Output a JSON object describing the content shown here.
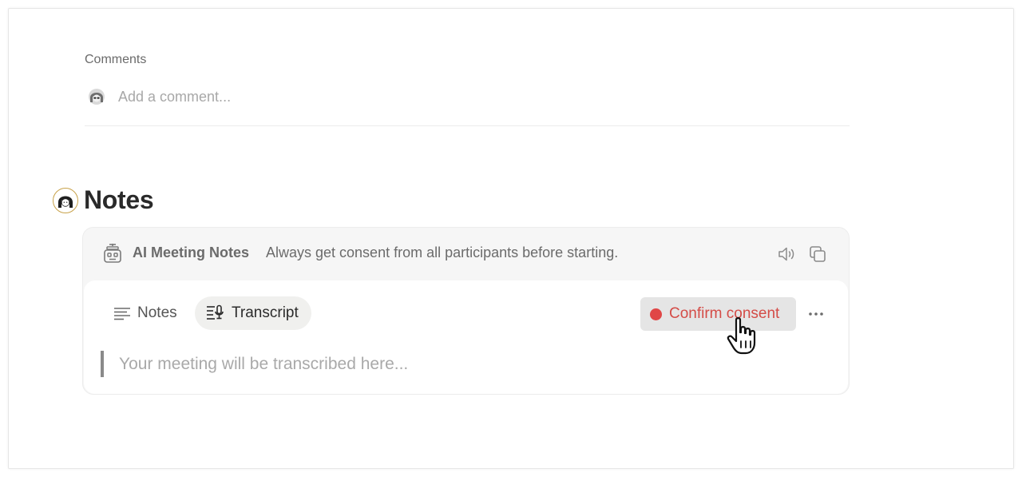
{
  "comments": {
    "heading": "Comments",
    "avatar_icon": "user-avatar-icon",
    "input_placeholder": "Add a comment..."
  },
  "notes_section": {
    "avatar_icon": "notes-avatar-icon",
    "title": "Notes"
  },
  "meeting_card": {
    "icon": "robot-icon",
    "title": "AI Meeting Notes",
    "subtitle": "Always get consent from all participants before starting.",
    "speaker_icon": "speaker-icon",
    "copy_icon": "copy-icon",
    "tabs": [
      {
        "label": "Notes",
        "icon": "lines-icon",
        "active": false
      },
      {
        "label": "Transcript",
        "icon": "transcript-icon",
        "active": true
      }
    ],
    "confirm_button": {
      "label": "Confirm consent",
      "dot_color": "#e04646",
      "text_color": "#d44c47"
    },
    "more_icon": "more-icon",
    "transcript_placeholder": "Your meeting will be transcribed here..."
  },
  "colors": {
    "accent_red": "#d44c47",
    "avatar_ring": "#c8a24a",
    "card_bg": "#f6f6f6"
  }
}
